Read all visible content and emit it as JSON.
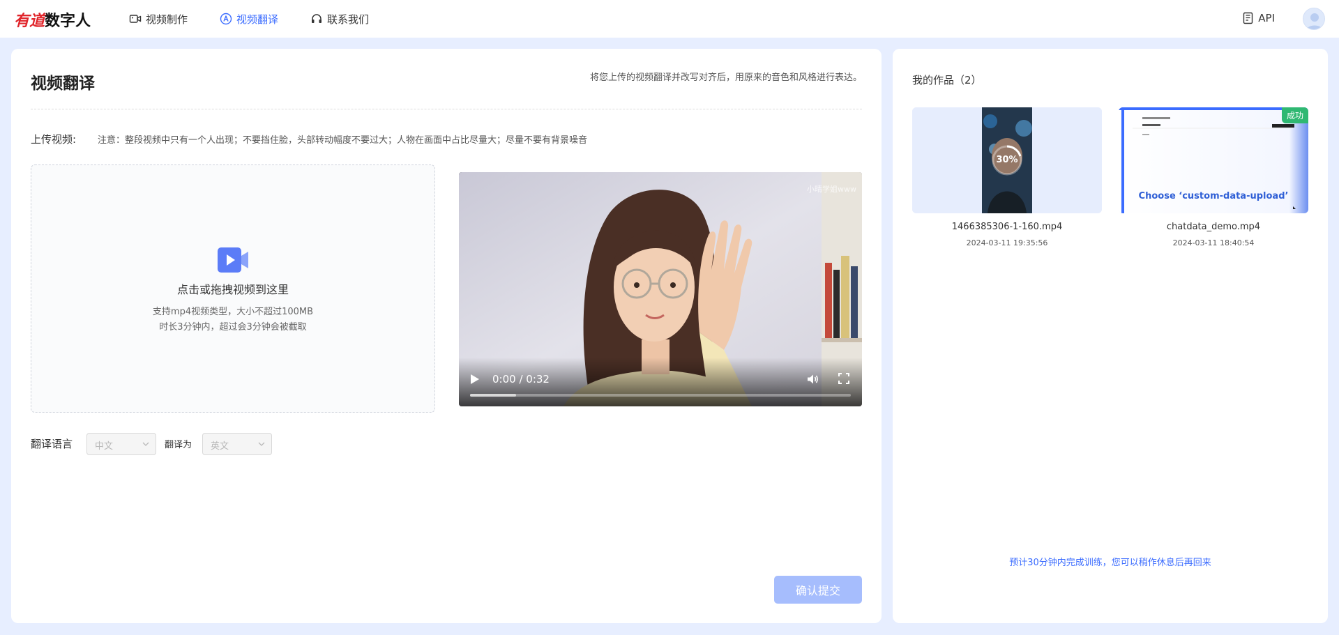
{
  "header": {
    "logo_brand": "有道",
    "logo_rest": "数字人",
    "nav": [
      {
        "label": "视频制作",
        "icon": "video-camera-icon",
        "active": false
      },
      {
        "label": "视频翻译",
        "icon": "translate-icon",
        "active": true
      },
      {
        "label": "联系我们",
        "icon": "headset-icon",
        "active": false
      }
    ],
    "api_label": "API"
  },
  "main": {
    "title": "视频翻译",
    "description": "将您上传的视频翻译并改写对齐后，用原来的音色和风格进行表达。",
    "upload_label": "上传视频:",
    "upload_note": "注意：整段视频中只有一个人出现；不要挡住脸，头部转动幅度不要过大；人物在画面中占比尽量大；尽量不要有背景噪音",
    "dropzone": {
      "title": "点击或拖拽视频到这里",
      "line1": "支持mp4视频类型，大小不超过100MB",
      "line2": "时长3分钟内，超过会3分钟会被截取"
    },
    "player": {
      "watermark": "小晴学姐www",
      "time": "0:00 / 0:32",
      "progress": 0.12
    },
    "language": {
      "label": "翻译语言",
      "source": "中文",
      "to_label": "翻译为",
      "target": "英文"
    },
    "submit_label": "确认提交"
  },
  "side": {
    "title": "我的作品（2）",
    "works": [
      {
        "name": "1466385306-1-160.mp4",
        "date": "2024-03-11 19:35:56",
        "progress": "30%"
      },
      {
        "name": "chatdata_demo.mp4",
        "date": "2024-03-11 18:40:54",
        "badge": "成功",
        "overlay_text": "Choose ‘custom-data-upload’"
      }
    ],
    "footer": "预计30分钟内完成训练，您可以稍作休息后再回来"
  },
  "colors": {
    "accent": "#3b6cff",
    "page_bg": "#e7eeff",
    "brand_red": "#e0252b",
    "success": "#2fb872",
    "submit_disabled": "#a6bdfd"
  }
}
